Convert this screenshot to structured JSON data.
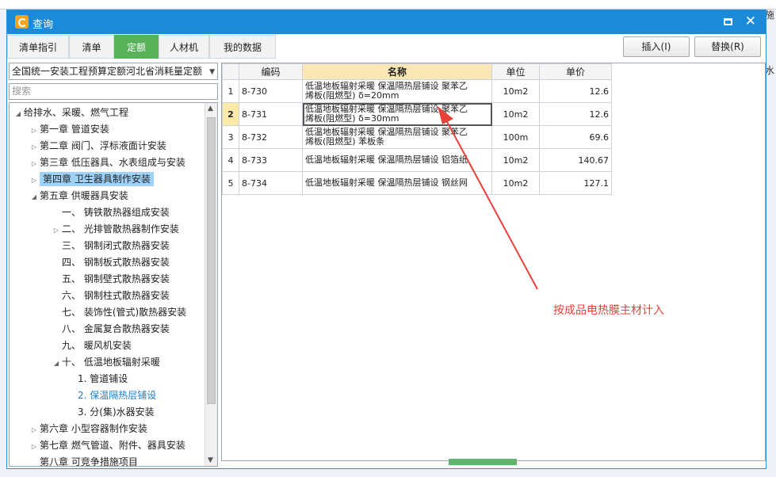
{
  "background": {
    "right_top_text": "施",
    "right_mid_text": "排水"
  },
  "window": {
    "title": "查询"
  },
  "tabs": [
    {
      "label": "清单指引"
    },
    {
      "label": "清单"
    },
    {
      "label": "定额"
    },
    {
      "label": "人材机"
    },
    {
      "label": "我的数据"
    }
  ],
  "active_tab": "定额",
  "buttons": {
    "insert": "插入(I)",
    "replace": "替换(R)"
  },
  "library": {
    "selected": "全国统一安装工程预算定额河北省消耗量定额"
  },
  "search": {
    "placeholder": "搜索"
  },
  "tree": [
    {
      "label": "给排水、采暖、燃气工程"
    },
    {
      "label": "第一章 管道安装"
    },
    {
      "label": "第二章 阀门、浮标液面计安装"
    },
    {
      "label": "第三章 低压器具、水表组成与安装"
    },
    {
      "label": "第四章 卫生器具制作安装"
    },
    {
      "label": "第五章 供暖器具安装"
    },
    {
      "label": "一、 铸铁散热器组成安装"
    },
    {
      "label": "二、 光排管散热器制作安装"
    },
    {
      "label": "三、 钢制闭式散热器安装"
    },
    {
      "label": "四、 钢制板式散热器安装"
    },
    {
      "label": "五、 钢制壁式散热器安装"
    },
    {
      "label": "六、 钢制柱式散热器安装"
    },
    {
      "label": "七、 装饰性(管式)散热器安装"
    },
    {
      "label": "八、 金属复合散热器安装"
    },
    {
      "label": "九、 暖风机安装"
    },
    {
      "label": "十、 低温地板辐射采暖"
    },
    {
      "label": "1. 管道铺设"
    },
    {
      "label": "2. 保温隔热层铺设"
    },
    {
      "label": "3. 分(集)水器安装"
    },
    {
      "label": "第六章 小型容器制作安装"
    },
    {
      "label": "第七章 燃气管道、附件、器具安装"
    },
    {
      "label": "第八章 可竞争措施项目"
    }
  ],
  "tree_selected": "第四章 卫生器具制作安装",
  "grid": {
    "headers": {
      "code": "编码",
      "name": "名称",
      "unit": "单位",
      "price": "单价"
    },
    "rows": [
      {
        "idx": "1",
        "code": "8-730",
        "name1": "低温地板辐射采暖 保温隔热层铺设 聚苯乙",
        "name2": "烯板(阻燃型) δ=20mm",
        "unit": "10m2",
        "price": "12.6"
      },
      {
        "idx": "2",
        "code": "8-731",
        "name1": "低温地板辐射采暖 保温隔热层铺设 聚苯乙",
        "name2": "烯板(阻燃型) δ=30mm",
        "unit": "10m2",
        "price": "12.6"
      },
      {
        "idx": "3",
        "code": "8-732",
        "name1": "低温地板辐射采暖 保温隔热层铺设 聚苯乙",
        "name2": "烯板(阻燃型) 苯板条",
        "unit": "100m",
        "price": "69.6"
      },
      {
        "idx": "4",
        "code": "8-733",
        "name1": "低温地板辐射采暖 保温隔热层铺设 铝箔纸",
        "name2": "",
        "unit": "10m2",
        "price": "140.67"
      },
      {
        "idx": "5",
        "code": "8-734",
        "name1": "低温地板辐射采暖 保温隔热层铺设 钢丝网",
        "name2": "",
        "unit": "10m2",
        "price": "127.1"
      }
    ]
  },
  "annotation": {
    "text": "按成品电热膜主材计入",
    "color": "#e8413a"
  }
}
